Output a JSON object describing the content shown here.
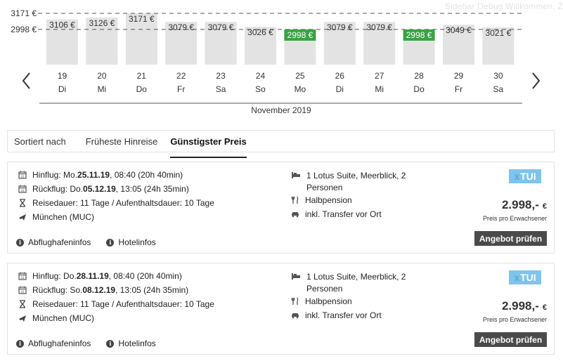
{
  "debug": {
    "text": "Sidebar Debug   Willkommen, Z"
  },
  "chart_data": {
    "type": "bar",
    "month_label": "November 2019",
    "ylim": [
      2620,
      3171
    ],
    "reference_lines": [
      {
        "label": "3171 €",
        "value": 3171
      },
      {
        "label": "2998 €",
        "value": 2998
      }
    ],
    "categories": [
      {
        "day": "19",
        "weekday": "Di"
      },
      {
        "day": "20",
        "weekday": "Mi"
      },
      {
        "day": "21",
        "weekday": "Do"
      },
      {
        "day": "22",
        "weekday": "Fr"
      },
      {
        "day": "23",
        "weekday": "Sa"
      },
      {
        "day": "24",
        "weekday": "So"
      },
      {
        "day": "25",
        "weekday": "Mo"
      },
      {
        "day": "26",
        "weekday": "Di"
      },
      {
        "day": "27",
        "weekday": "Mi"
      },
      {
        "day": "28",
        "weekday": "Do"
      },
      {
        "day": "29",
        "weekday": "Fr"
      },
      {
        "day": "30",
        "weekday": "Sa"
      }
    ],
    "values": [
      3106,
      3126,
      3171,
      3079,
      3079,
      3026,
      2998,
      3079,
      3079,
      2998,
      3049,
      3021
    ],
    "value_labels": [
      "3106 €",
      "3126 €",
      "3171 €",
      "3079 €",
      "3079 €",
      "3026 €",
      "2998 €",
      "3079 €",
      "3079 €",
      "2998 €",
      "3049 €",
      "3021 €"
    ],
    "highlighted": [
      false,
      false,
      false,
      false,
      false,
      false,
      true,
      false,
      false,
      true,
      false,
      false
    ],
    "colors": {
      "bar": "#e3e3e3",
      "highlight": "#3aa146",
      "text": "#333333"
    }
  },
  "sort": {
    "label": "Sortiert nach",
    "options": [
      "Früheste Hinreise",
      "Günstigster Preis"
    ],
    "active": "Günstigster Preis"
  },
  "offers": [
    {
      "outbound_prefix": "Hinflug: Mo. ",
      "outbound_date": "25.11.19",
      "outbound_rest": ", 08:40 (20h 40min)",
      "return_prefix": "Rückflug: Do. ",
      "return_date": "05.12.19",
      "return_rest": ", 13:05 (24h 35min)",
      "duration": "Reisedauer: 11 Tage / Aufenthaltsdauer: 10 Tage",
      "airport": "München (MUC)",
      "room": "1 Lotus Suite, Meerblick, 2 Personen",
      "board": "Halbpension",
      "transfer": "inkl. Transfer vor Ort",
      "operator": "TUI",
      "price": "2.998,-",
      "currency": "€",
      "price_note": "Preis pro Erwachsener",
      "cta": "Angebot prüfen",
      "link_airport": "Abflughafeninfos",
      "link_hotel": "Hotelinfos"
    },
    {
      "outbound_prefix": "Hinflug: Do. ",
      "outbound_date": "28.11.19",
      "outbound_rest": ", 08:40 (20h 40min)",
      "return_prefix": "Rückflug: So. ",
      "return_date": "08.12.19",
      "return_rest": ", 13:05 (24h 35min)",
      "duration": "Reisedauer: 11 Tage / Aufenthaltsdauer: 10 Tage",
      "airport": "München (MUC)",
      "room": "1 Lotus Suite, Meerblick, 2 Personen",
      "board": "Halbpension",
      "transfer": "inkl. Transfer vor Ort",
      "operator": "TUI",
      "price": "2.998,-",
      "currency": "€",
      "price_note": "Preis pro Erwachsener",
      "cta": "Angebot prüfen",
      "link_airport": "Abflughafeninfos",
      "link_hotel": "Hotelinfos"
    }
  ]
}
